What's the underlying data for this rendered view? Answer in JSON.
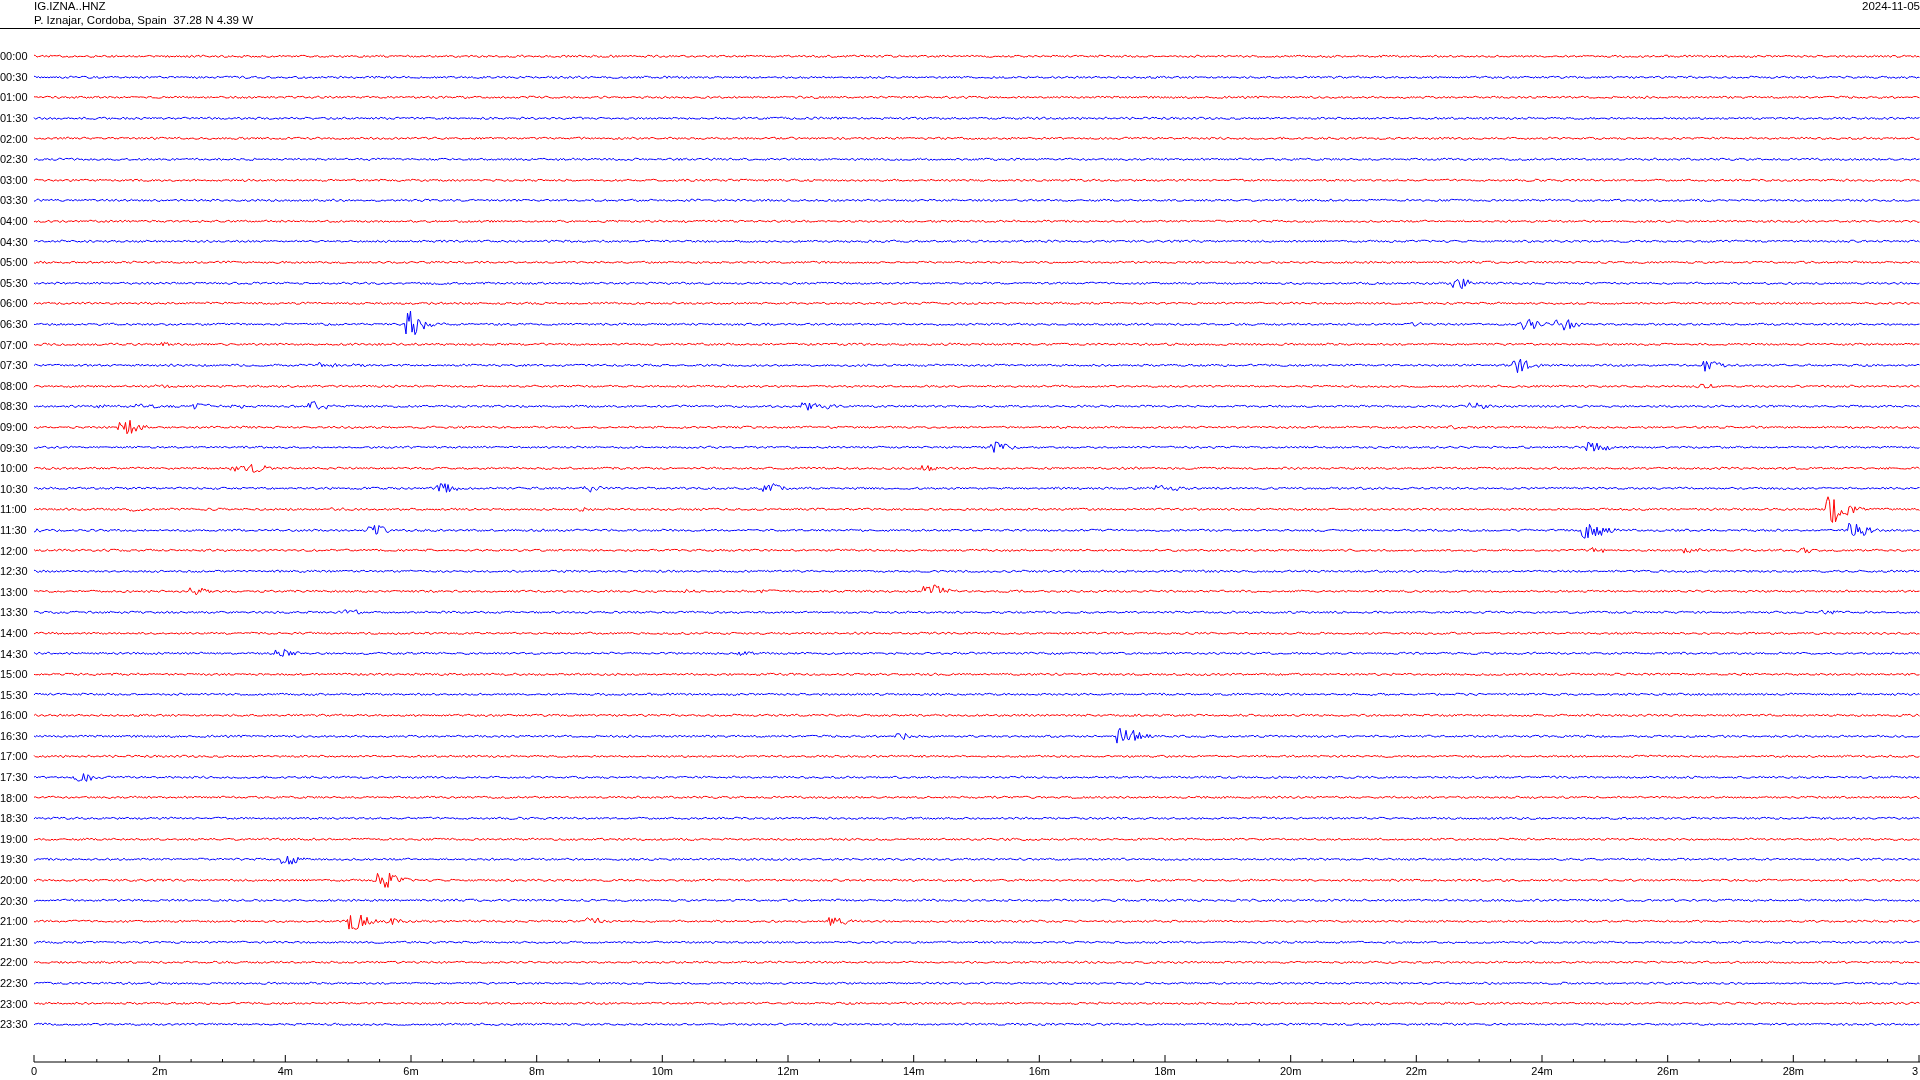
{
  "header": {
    "station": "IG.IZNA..HNZ",
    "location": "P. Iznajar, Cordoba, Spain  37.28 N 4.39 W",
    "date": "2024-11-05"
  },
  "rows": [
    {
      "label": "00:00",
      "color": "#ff0000"
    },
    {
      "label": "00:30",
      "color": "#0000ff"
    },
    {
      "label": "01:00",
      "color": "#ff0000"
    },
    {
      "label": "01:30",
      "color": "#0000ff"
    },
    {
      "label": "02:00",
      "color": "#ff0000"
    },
    {
      "label": "02:30",
      "color": "#0000ff"
    },
    {
      "label": "03:00",
      "color": "#ff0000"
    },
    {
      "label": "03:30",
      "color": "#0000ff"
    },
    {
      "label": "04:00",
      "color": "#ff0000"
    },
    {
      "label": "04:30",
      "color": "#0000ff"
    },
    {
      "label": "05:00",
      "color": "#ff0000"
    },
    {
      "label": "05:30",
      "color": "#0000ff"
    },
    {
      "label": "06:00",
      "color": "#ff0000"
    },
    {
      "label": "06:30",
      "color": "#0000ff"
    },
    {
      "label": "07:00",
      "color": "#ff0000"
    },
    {
      "label": "07:30",
      "color": "#0000ff"
    },
    {
      "label": "08:00",
      "color": "#ff0000"
    },
    {
      "label": "08:30",
      "color": "#0000ff"
    },
    {
      "label": "09:00",
      "color": "#ff0000"
    },
    {
      "label": "09:30",
      "color": "#0000ff"
    },
    {
      "label": "10:00",
      "color": "#ff0000"
    },
    {
      "label": "10:30",
      "color": "#0000ff"
    },
    {
      "label": "11:00",
      "color": "#ff0000"
    },
    {
      "label": "11:30",
      "color": "#0000ff"
    },
    {
      "label": "12:00",
      "color": "#ff0000"
    },
    {
      "label": "12:30",
      "color": "#0000ff"
    },
    {
      "label": "13:00",
      "color": "#ff0000"
    },
    {
      "label": "13:30",
      "color": "#0000ff"
    },
    {
      "label": "14:00",
      "color": "#ff0000"
    },
    {
      "label": "14:30",
      "color": "#0000ff"
    },
    {
      "label": "15:00",
      "color": "#ff0000"
    },
    {
      "label": "15:30",
      "color": "#0000ff"
    },
    {
      "label": "16:00",
      "color": "#ff0000"
    },
    {
      "label": "16:30",
      "color": "#0000ff"
    },
    {
      "label": "17:00",
      "color": "#ff0000"
    },
    {
      "label": "17:30",
      "color": "#0000ff"
    },
    {
      "label": "18:00",
      "color": "#ff0000"
    },
    {
      "label": "18:30",
      "color": "#0000ff"
    },
    {
      "label": "19:00",
      "color": "#ff0000"
    },
    {
      "label": "19:30",
      "color": "#0000ff"
    },
    {
      "label": "20:00",
      "color": "#ff0000"
    },
    {
      "label": "20:30",
      "color": "#0000ff"
    },
    {
      "label": "21:00",
      "color": "#ff0000"
    },
    {
      "label": "21:30",
      "color": "#0000ff"
    },
    {
      "label": "22:00",
      "color": "#ff0000"
    },
    {
      "label": "22:30",
      "color": "#0000ff"
    },
    {
      "label": "23:00",
      "color": "#ff0000"
    },
    {
      "label": "23:30",
      "color": "#0000ff"
    }
  ],
  "x_axis": {
    "tick_labels": [
      "0",
      "2m",
      "4m",
      "6m",
      "8m",
      "10m",
      "12m",
      "14m",
      "16m",
      "18m",
      "20m",
      "22m",
      "24m",
      "26m",
      "28m",
      "3"
    ]
  }
}
